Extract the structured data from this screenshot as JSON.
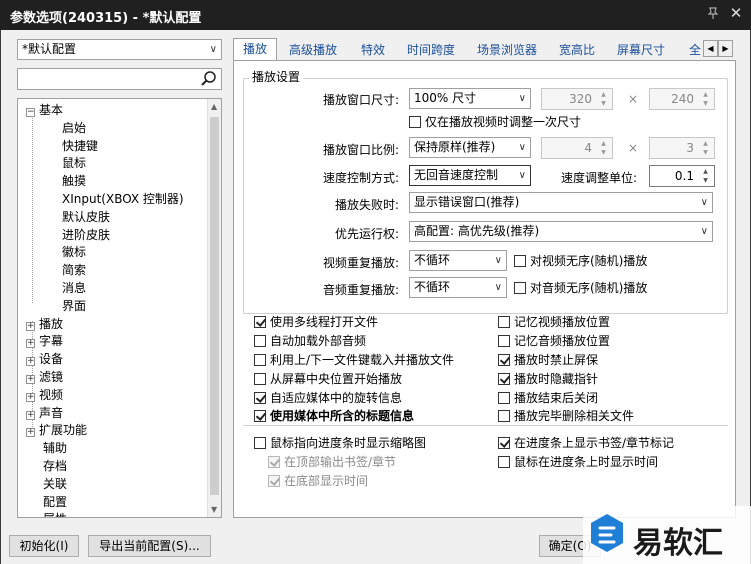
{
  "window": {
    "title": "参数选项(240315) - *默认配置"
  },
  "left": {
    "profile_combo": "*默认配置",
    "search_placeholder": "",
    "tree": [
      {
        "label": "基本",
        "level": 0,
        "expander": "-"
      },
      {
        "label": "启始",
        "level": 1
      },
      {
        "label": "快捷键",
        "level": 1
      },
      {
        "label": "鼠标",
        "level": 1
      },
      {
        "label": "触摸",
        "level": 1
      },
      {
        "label": "XInput(XBOX 控制器)",
        "level": 1
      },
      {
        "label": "默认皮肤",
        "level": 1
      },
      {
        "label": "进阶皮肤",
        "level": 1
      },
      {
        "label": "徽标",
        "level": 1
      },
      {
        "label": "简索",
        "level": 1
      },
      {
        "label": "消息",
        "level": 1
      },
      {
        "label": "界面",
        "level": 1
      },
      {
        "label": "播放",
        "level": 0,
        "expander": "+"
      },
      {
        "label": "字幕",
        "level": 0,
        "expander": "+"
      },
      {
        "label": "设备",
        "level": 0,
        "expander": "+"
      },
      {
        "label": "滤镜",
        "level": 0,
        "expander": "+"
      },
      {
        "label": "视频",
        "level": 0,
        "expander": "+"
      },
      {
        "label": "声音",
        "level": 0,
        "expander": "+"
      },
      {
        "label": "扩展功能",
        "level": 0,
        "expander": "+"
      },
      {
        "label": "辅助",
        "level": 0
      },
      {
        "label": "存档",
        "level": 0
      },
      {
        "label": "关联",
        "level": 0
      },
      {
        "label": "配置",
        "level": 0
      },
      {
        "label": "属性",
        "level": 0
      }
    ]
  },
  "footer": {
    "init_button": "初始化(I)",
    "export_button": "导出当前配置(S)...",
    "ok_button": "确定(O)"
  },
  "tabs": [
    "播放",
    "高级播放",
    "特效",
    "时间跨度",
    "场景浏览器",
    "宽高比",
    "屏幕尺寸",
    "全"
  ],
  "playback": {
    "group_title": "播放设置",
    "window_size_label": "播放窗口尺寸:",
    "window_size_value": "100% 尺寸",
    "width_value": "320",
    "height_value": "240",
    "times": "×",
    "adjust_once": "仅在播放视频时调整一次尺寸",
    "ratio_label": "播放窗口比例:",
    "ratio_value": "保持原样(推荐)",
    "ratio_w": "4",
    "ratio_h": "3",
    "speed_label": "速度控制方式:",
    "speed_value": "无回音速度控制",
    "speed_unit_label": "速度调整单位:",
    "speed_unit_value": "0.1",
    "fail_label": "播放失败时:",
    "fail_value": "显示错误窗口(推荐)",
    "priority_label": "优先运行权:",
    "priority_value": "高配置: 高优先级(推荐)",
    "video_repeat_label": "视频重复播放:",
    "video_repeat_value": "不循环",
    "video_shuffle": "对视频无序(随机)播放",
    "audio_repeat_label": "音频重复播放:",
    "audio_repeat_value": "不循环",
    "audio_shuffle": "对音频无序(随机)播放"
  },
  "options_left": [
    {
      "label": "使用多线程打开文件",
      "checked": true
    },
    {
      "label": "自动加载外部音频",
      "checked": false
    },
    {
      "label": "利用上/下一文件键载入并播放文件",
      "checked": false
    },
    {
      "label": "从屏幕中央位置开始播放",
      "checked": false
    },
    {
      "label": "自适应媒体中的旋转信息",
      "checked": true
    },
    {
      "label": "使用媒体中所含的标题信息",
      "checked": true
    }
  ],
  "options_right": [
    {
      "label": "记忆视频播放位置",
      "checked": false
    },
    {
      "label": "记忆音频播放位置",
      "checked": false
    },
    {
      "label": "播放时禁止屏保",
      "checked": true
    },
    {
      "label": "播放时隐藏指针",
      "checked": true
    },
    {
      "label": "播放结束后关闭",
      "checked": false
    },
    {
      "label": "播放完毕删除相关文件",
      "checked": false
    }
  ],
  "seekbar": {
    "thumbnail": "鼠标指向进度条时显示缩略图",
    "top_bookmark": "在顶部输出书签/章节",
    "bottom_time": "在底部显示时间",
    "show_bookmarks": "在进度条上显示书签/章节标记",
    "show_time": "鼠标在进度条上时显示时间"
  },
  "watermark": {
    "text": "易软汇"
  },
  "colors": {
    "titlebar": "#202020",
    "tab_text": "#1a4e9a",
    "brand_blue": "#1f7fd6"
  }
}
